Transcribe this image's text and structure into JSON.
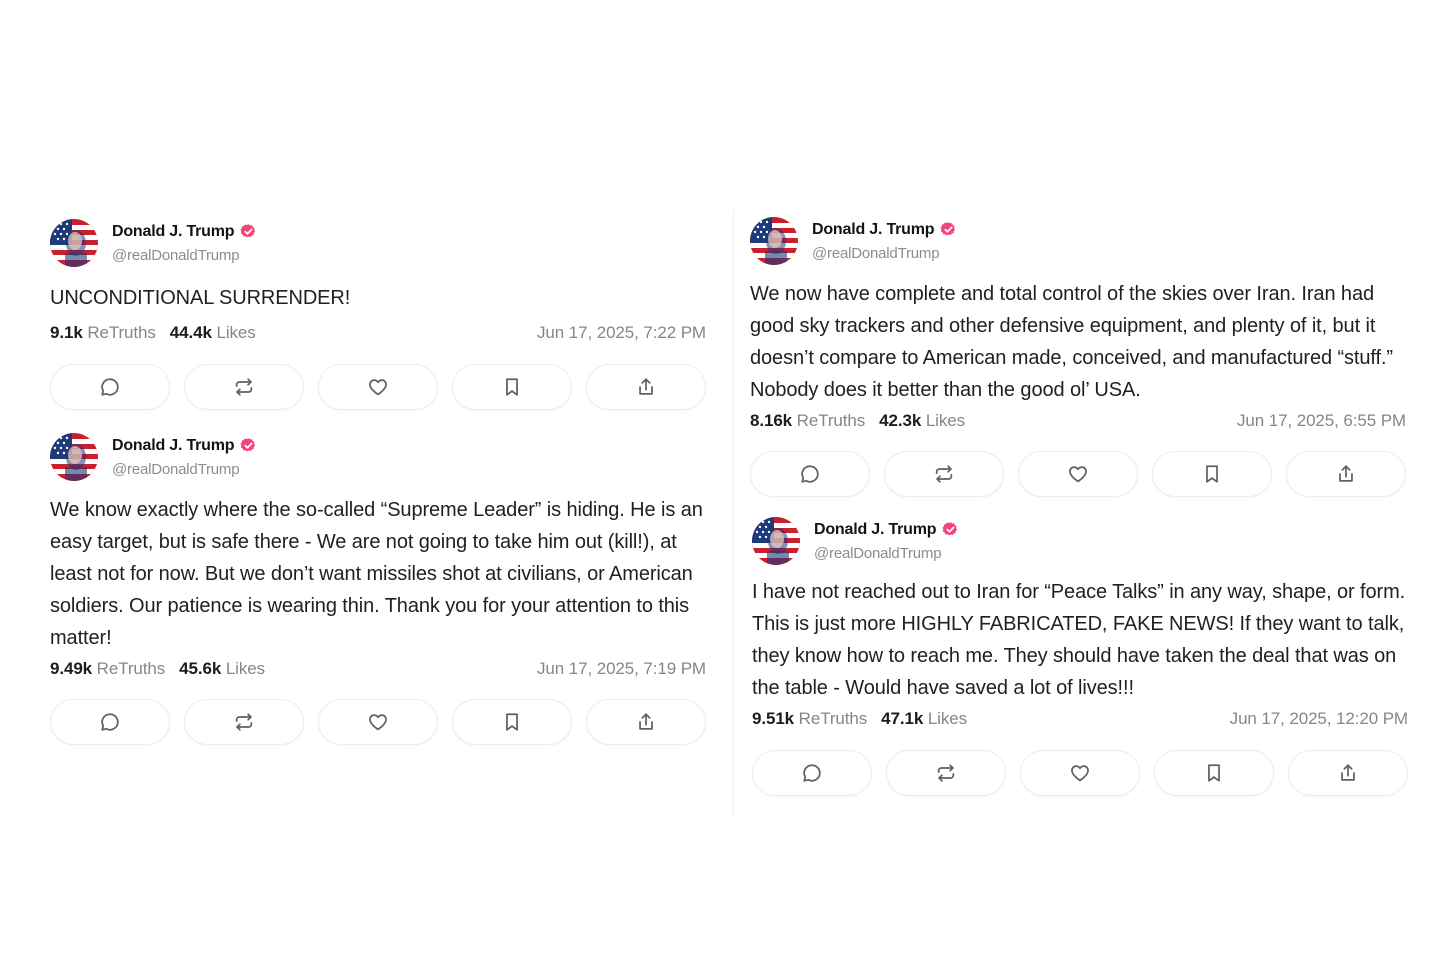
{
  "accent_colors": {
    "verified": "#f0467a",
    "text": "#1f1f24",
    "muted": "#85858e"
  },
  "posts": [
    {
      "author": "Donald J. Trump",
      "handle": "@realDonaldTrump",
      "text": "UNCONDITIONAL SURRENDER!",
      "retruths": "9.1k",
      "retruths_label": "ReTruths",
      "likes": "44.4k",
      "likes_label": "Likes",
      "date": "Jun 17, 2025, 7:22 PM"
    },
    {
      "author": "Donald J. Trump",
      "handle": "@realDonaldTrump",
      "text": "We know exactly where the so-called “Supreme Leader” is hiding. He is an easy target, but is safe there - We are not going to take him out (kill!), at least not for now. But we don’t want missiles shot at civilians, or American soldiers. Our patience is wearing thin. Thank you for your attention to this matter!",
      "retruths": "9.49k",
      "retruths_label": "ReTruths",
      "likes": "45.6k",
      "likes_label": "Likes",
      "date": "Jun 17, 2025, 7:19 PM"
    },
    {
      "author": "Donald J. Trump",
      "handle": "@realDonaldTrump",
      "text": "We now have complete and total control of the skies over Iran. Iran had good sky trackers and other defensive equipment, and plenty of it, but it doesn’t compare to American made, conceived, and manufactured “stuff.”  Nobody does it better than the good ol’ USA.",
      "retruths": "8.16k",
      "retruths_label": "ReTruths",
      "likes": "42.3k",
      "likes_label": "Likes",
      "date": "Jun 17, 2025, 6:55 PM"
    },
    {
      "author": "Donald J. Trump",
      "handle": "@realDonaldTrump",
      "text": "I have not reached out to Iran for “Peace Talks” in any way, shape, or form. This is just more HIGHLY FABRICATED, FAKE NEWS! If they want to talk, they know how to reach me. They should have taken the deal that was on the table - Would have saved a lot of lives!!!",
      "retruths": "9.51k",
      "retruths_label": "ReTruths",
      "likes": "47.1k",
      "likes_label": "Likes",
      "date": "Jun 17, 2025, 12:20 PM"
    }
  ],
  "action_icons": [
    "reply-icon",
    "retruth-icon",
    "like-icon",
    "bookmark-icon",
    "share-icon"
  ]
}
